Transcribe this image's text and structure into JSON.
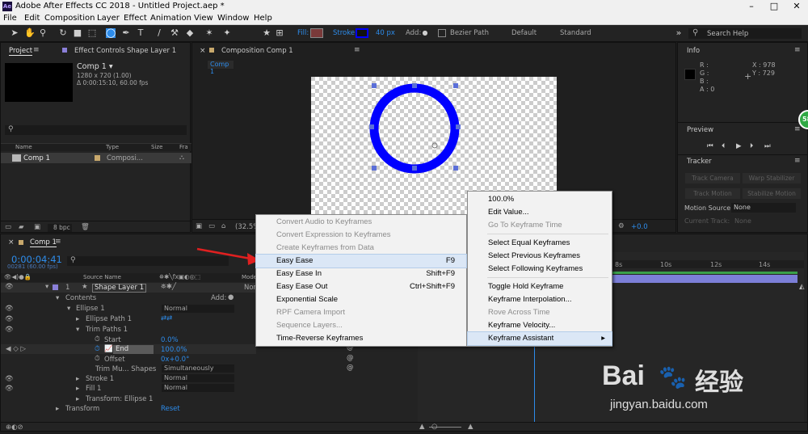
{
  "window": {
    "title": "Adobe After Effects CC 2018 - Untitled Project.aep *",
    "app_icon": "Ae"
  },
  "menubar": [
    "File",
    "Edit",
    "Composition",
    "Layer",
    "Effect",
    "Animation",
    "View",
    "Window",
    "Help"
  ],
  "toolbar": {
    "fill_label": "Fill:",
    "stroke_label": "Stroke:",
    "stroke_width": "40 px",
    "add_label": "Add:",
    "bezier_label": "Bezier Path",
    "workspace_default": "Default",
    "workspace_standard": "Standard",
    "search_placeholder": "Search Help",
    "fill_color": "#7a3a3a",
    "stroke_color": "#0000ff"
  },
  "project_panel": {
    "tab": "Project",
    "effect_tab": "Effect Controls Shape Layer 1",
    "comp_name": "Comp 1 ▾",
    "comp_size": "1280 x 720 (1.00)",
    "comp_duration": "Δ 0:00:15:10, 60.00 fps",
    "columns": [
      "Name",
      "Type",
      "Size",
      "Fra"
    ],
    "row": {
      "name": "Comp 1",
      "type": "Composi..."
    },
    "bpc": "8 bpc"
  },
  "comp_panel": {
    "tab": "Composition Comp 1",
    "subtab": "Comp 1",
    "zoom": "(32.5%)",
    "exposure": "+0.0"
  },
  "info_panel": {
    "title": "Info",
    "r": "R :",
    "g": "G :",
    "b": "B :",
    "a": "A : 0",
    "x": "X : 978",
    "y": "Y : 729"
  },
  "preview_panel": {
    "title": "Preview"
  },
  "tracker_panel": {
    "title": "Tracker",
    "buttons": [
      "Track Camera",
      "Warp Stabilizer",
      "Track Motion",
      "Stabilize Motion"
    ],
    "motion_source_label": "Motion Source:",
    "motion_source_value": "None",
    "current_track_label": "Current Track:",
    "current_track_value": "None"
  },
  "badge": "58",
  "timeline": {
    "tab": "Comp 1",
    "timecode": "0:00:04:41",
    "frames": "00281 (60.00 fps)",
    "col_source": "Source Name",
    "col_mode": "Mode",
    "layer": {
      "num": "1",
      "name": "Shape Layer 1",
      "mode": "Nor"
    },
    "rows": [
      {
        "label": "Contents",
        "value": "Add:"
      },
      {
        "label": "Ellipse 1",
        "value": "Normal"
      },
      {
        "label": "Ellipse Path 1",
        "value": ""
      },
      {
        "label": "Trim Paths 1",
        "value": ""
      },
      {
        "label": "Start",
        "value": "0.0%"
      },
      {
        "label": "End",
        "value": "100.0%"
      },
      {
        "label": "Offset",
        "value": "0x+0.0°"
      },
      {
        "label": "Trim Mu... Shapes",
        "value": "Simultaneously"
      },
      {
        "label": "Stroke 1",
        "value": "Normal"
      },
      {
        "label": "Fill 1",
        "value": "Normal"
      },
      {
        "label": "Transform: Ellipse 1",
        "value": ""
      },
      {
        "label": "Transform",
        "value": "Reset"
      }
    ],
    "ruler": [
      "8s",
      "10s",
      "12s",
      "14s"
    ]
  },
  "context_menu_left": [
    {
      "label": "Convert Audio to Keyframes",
      "shortcut": "",
      "disabled": true
    },
    {
      "label": "Convert Expression to Keyframes",
      "shortcut": "",
      "disabled": true
    },
    {
      "label": "Create Keyframes from Data",
      "shortcut": "",
      "disabled": true
    },
    {
      "label": "Easy Ease",
      "shortcut": "F9",
      "disabled": false
    },
    {
      "label": "Easy Ease In",
      "shortcut": "Shift+F9",
      "disabled": false
    },
    {
      "label": "Easy Ease Out",
      "shortcut": "Ctrl+Shift+F9",
      "disabled": false
    },
    {
      "label": "Exponential Scale",
      "shortcut": "",
      "disabled": false
    },
    {
      "label": "RPF Camera Import",
      "shortcut": "",
      "disabled": true
    },
    {
      "label": "Sequence Layers...",
      "shortcut": "",
      "disabled": true
    },
    {
      "label": "Time-Reverse Keyframes",
      "shortcut": "",
      "disabled": false
    }
  ],
  "context_menu_right": [
    {
      "label": "100.0%",
      "disabled": false
    },
    {
      "label": "Edit Value...",
      "disabled": false
    },
    {
      "label": "Go To Keyframe Time",
      "disabled": true
    },
    {
      "label": "Select Equal Keyframes",
      "disabled": false
    },
    {
      "label": "Select Previous Keyframes",
      "disabled": false
    },
    {
      "label": "Select Following Keyframes",
      "disabled": false
    },
    {
      "label": "Toggle Hold Keyframe",
      "disabled": false
    },
    {
      "label": "Keyframe Interpolation...",
      "disabled": false
    },
    {
      "label": "Rove Across Time",
      "disabled": true
    },
    {
      "label": "Keyframe Velocity...",
      "disabled": false
    },
    {
      "label": "Keyframe Assistant",
      "disabled": false
    }
  ],
  "watermark": {
    "brand": "Bai",
    "brand2": "经验",
    "url": "jingyan.baidu.com"
  }
}
